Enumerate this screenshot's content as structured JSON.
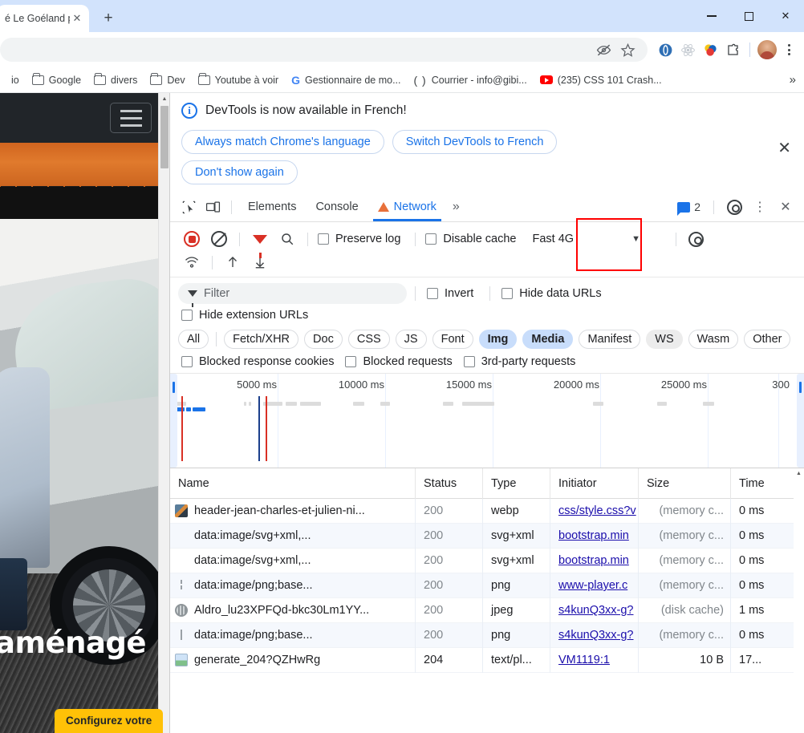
{
  "window": {
    "minimize_label": "–",
    "maximize_label": "□",
    "close_label": "✕"
  },
  "tabstrip": {
    "tab_title": "é Le Goéland pa",
    "tab_close_label": "✕",
    "new_tab_label": "+"
  },
  "toolbar": {
    "incognito_eye_icon": "eye-off-icon",
    "bookmark_star_icon": "star-icon",
    "extensions": [
      "opera-touch-icon",
      "react-devtools-icon",
      "colorzilla-icon",
      "extensions-puzzle-icon"
    ],
    "profile_icon": "avatar",
    "menu_label": "⋮"
  },
  "bookmarks": {
    "items": [
      {
        "label": "io",
        "icon": "none"
      },
      {
        "label": "Google",
        "icon": "folder-icon"
      },
      {
        "label": "divers",
        "icon": "folder-icon"
      },
      {
        "label": "Dev",
        "icon": "folder-icon"
      },
      {
        "label": "Youtube à voir",
        "icon": "folder-icon"
      },
      {
        "label": "Gestionnaire de mo...",
        "icon": "google-icon"
      },
      {
        "label": "Courrier - info@gibi...",
        "icon": "parentheses-icon"
      },
      {
        "label": "(235) CSS 101 Crash...",
        "icon": "youtube-icon"
      }
    ],
    "overflow_label": "»"
  },
  "page": {
    "nav": {
      "menu_toggle": "hamburger-icon"
    },
    "hero": {
      "headline": "aménagé",
      "cta_label": "Configurez votre"
    },
    "scrollbar": {
      "up_arrow": "▲"
    }
  },
  "devtools": {
    "banner": {
      "info_icon": "info-icon",
      "message": "DevTools is now available in French!",
      "buttons": [
        "Always match Chrome's language",
        "Switch DevTools to French",
        "Don't show again"
      ],
      "close_label": "✕"
    },
    "tabs": {
      "inspect_icon": "inspect-element-icon",
      "device_icon": "device-toolbar-icon",
      "items": [
        {
          "label": "Elements",
          "active": false,
          "warn": false
        },
        {
          "label": "Console",
          "active": false,
          "warn": false
        },
        {
          "label": "Network",
          "active": true,
          "warn": true
        }
      ],
      "more_label": "»",
      "message_count": "2",
      "settings_icon": "gear-icon",
      "menu_label": "⋮",
      "close_label": "✕"
    },
    "network_toolbar": {
      "record_icon": "record-stop-icon",
      "clear_icon": "clear-icon",
      "filter_icon": "filter-funnel-icon",
      "search_icon": "search-icon",
      "preserve_log_label": "Preserve log",
      "preserve_log_checked": false,
      "disable_cache_label": "Disable cache",
      "disable_cache_checked": false,
      "throttle_value": "Fast 4G",
      "throttle_caret": "▼",
      "settings_icon": "gear-icon",
      "wifi_icon": "network-conditions-icon",
      "import_icon": "import-har-icon",
      "export_icon": "export-har-icon",
      "highlight_color": "#ff0000"
    },
    "filters": {
      "filter_placeholder": "Filter",
      "filter_value": "",
      "invert_label": "Invert",
      "invert_checked": false,
      "hide_data_urls_label": "Hide data URLs",
      "hide_data_urls_checked": false,
      "hide_extension_urls_label": "Hide extension URLs",
      "hide_extension_urls_checked": false,
      "type_chips": [
        {
          "label": "All",
          "state": "normal"
        },
        {
          "label": "Fetch/XHR",
          "state": "normal"
        },
        {
          "label": "Doc",
          "state": "normal"
        },
        {
          "label": "CSS",
          "state": "normal"
        },
        {
          "label": "JS",
          "state": "normal"
        },
        {
          "label": "Font",
          "state": "normal"
        },
        {
          "label": "Img",
          "state": "selected"
        },
        {
          "label": "Media",
          "state": "selected"
        },
        {
          "label": "Manifest",
          "state": "normal"
        },
        {
          "label": "WS",
          "state": "hover"
        },
        {
          "label": "Wasm",
          "state": "normal"
        },
        {
          "label": "Other",
          "state": "normal"
        }
      ],
      "blocked_response_cookies_label": "Blocked response cookies",
      "blocked_response_cookies_checked": false,
      "blocked_requests_label": "Blocked requests",
      "blocked_requests_checked": false,
      "third_party_requests_label": "3rd-party requests",
      "third_party_requests_checked": false
    },
    "overview": {
      "tick_labels": [
        "5000 ms",
        "10000 ms",
        "15000 ms",
        "20000 ms",
        "25000 ms",
        "300"
      ]
    },
    "requests_table": {
      "columns": [
        "Name",
        "Status",
        "Type",
        "Initiator",
        "Size",
        "Time"
      ],
      "rows": [
        {
          "icon": "image-thumb-icon",
          "name": "header-jean-charles-et-julien-ni...",
          "status": "200",
          "type": "webp",
          "initiator": "css/style.css?v",
          "size": "(memory c...",
          "time": "0 ms"
        },
        {
          "icon": "none",
          "name": "data:image/svg+xml,...",
          "status": "200",
          "type": "svg+xml",
          "initiator": "bootstrap.min",
          "size": "(memory c...",
          "time": "0 ms"
        },
        {
          "icon": "none",
          "name": "data:image/svg+xml,...",
          "status": "200",
          "type": "svg+xml",
          "initiator": "bootstrap.min",
          "size": "(memory c...",
          "time": "0 ms"
        },
        {
          "icon": "bar-icon",
          "name": "data:image/png;base...",
          "status": "200",
          "type": "png",
          "initiator": "www-player.c",
          "size": "(memory c...",
          "time": "0 ms"
        },
        {
          "icon": "globe-icon",
          "name": "Aldro_lu23XPFQd-bkc30Lm1YY...",
          "status": "200",
          "type": "jpeg",
          "initiator": "s4kunQ3xx-g?",
          "size": "(disk cache)",
          "time": "1 ms"
        },
        {
          "icon": "bar-icon",
          "name": "data:image/png;base...",
          "status": "200",
          "type": "png",
          "initiator": "s4kunQ3xx-g?",
          "size": "(memory c...",
          "time": "0 ms"
        },
        {
          "icon": "document-icon",
          "name": "generate_204?QZHwRg",
          "status": "204",
          "type": "text/pl...",
          "initiator": "VM1119:1",
          "size": "10 B",
          "time": "17..."
        }
      ]
    }
  }
}
